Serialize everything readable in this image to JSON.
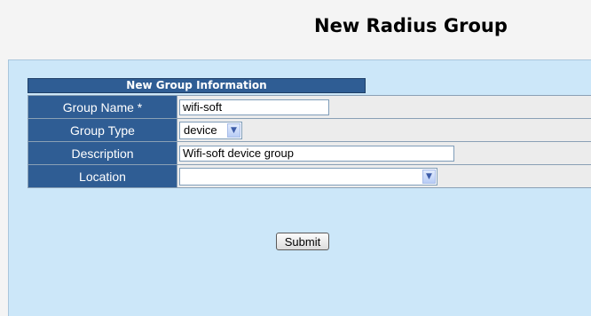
{
  "header": {
    "title": "New Radius Group"
  },
  "form": {
    "section_title": "New Group Information",
    "fields": [
      {
        "label": "Group Name *",
        "value": "wifi-soft"
      },
      {
        "label": "Group Type",
        "value": "device"
      },
      {
        "label": "Description",
        "value": "Wifi-soft device group"
      },
      {
        "label": "Location",
        "value": ""
      }
    ],
    "submit_label": "Submit"
  },
  "icons": {
    "select_arrow": "chevron-down-icon"
  },
  "colors": {
    "header_blue": "#2f5d94",
    "panel_background": "#cce7f9",
    "field_background": "#ececec"
  }
}
